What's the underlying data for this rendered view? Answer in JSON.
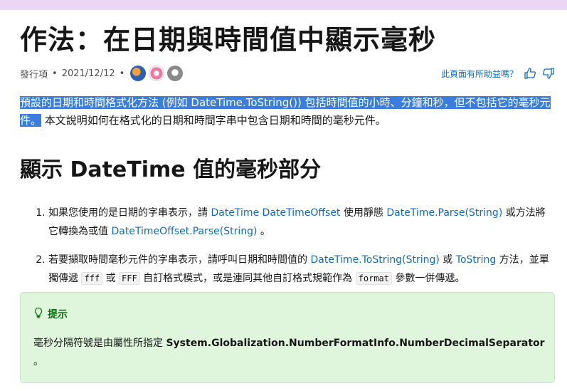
{
  "article": {
    "title": "作法：在日期與時間值中顯示毫秒",
    "meta": {
      "label": "發行項",
      "sep": "•",
      "date": "2021/12/12",
      "sep2": "•",
      "feedback_question": "此頁面有所助益嗎？",
      "icons": {
        "like": "thumbs-up-icon",
        "dislike": "thumbs-down-icon"
      }
    },
    "intro": {
      "highlighted": "預設的日期和時間格式化方法 (例如 DateTime.ToString()) 包括時間值的小時、分鐘和秒，但不包括它的毫秒元件。",
      "rest": "本文說明如何在格式化的日期和時間字串中包含日期和時間的毫秒元件。"
    },
    "section_heading": "顯示 DateTime 值的毫秒部分",
    "steps": [
      {
        "t1": "如果您使用的是日期的字串表示，請 ",
        "l1": "DateTime",
        "sp": " ",
        "l2": "DateTimeOffset",
        "t2": " 使用靜態 ",
        "l3": "DateTime.Parse(String)",
        "t3": " 或方法將它轉換為或值 ",
        "l4": "DateTimeOffset.Parse(String)",
        "t4": " 。"
      },
      {
        "t1": "若要擷取時間毫秒元件的字串表示，請呼叫日期和時間值的 ",
        "l1": "DateTime.ToString(String)",
        "t2": " 或 ",
        "l2": "ToString",
        "t3": " 方法，並單獨傳遞 ",
        "c1": "fff",
        "t4": " 或 ",
        "c2": "FFF",
        "t5": " 自訂格式模式，或是連同其他自訂格式規範作為 ",
        "c3": "format",
        "t6": " 參數一併傳遞。"
      }
    ],
    "tip": {
      "title": "提示",
      "body_text": "毫秒分隔符號是由屬性所指定 ",
      "body_bold": "System.Globalization.NumberFormatInfo.NumberDecimalSeparator",
      "body_end": "。"
    },
    "colors": {
      "link": "#0f6cbd",
      "highlight": "#3b7ddd",
      "tip_bg": "#dff6dd",
      "tip_title": "#0e700e",
      "topbar": "#ead7f7"
    }
  }
}
